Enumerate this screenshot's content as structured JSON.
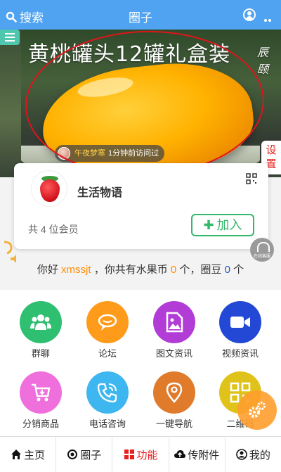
{
  "header": {
    "search_label": "搜索",
    "title": "圈子"
  },
  "banner": {
    "title": "黄桃罐头12罐礼盒装",
    "brand": "辰颐",
    "visitor_name": "午夜梦寒",
    "visit_text": "1分钟前访问过"
  },
  "settings_label": "设置",
  "circle": {
    "name": "生活物语",
    "members_text": "共 4 位会员",
    "join_label": "加入"
  },
  "greeting": {
    "prefix": "你好",
    "username": "xmssjt",
    "mid1": "，你共有水果币",
    "coins": "0",
    "mid2": "个，圈豆",
    "beans": "0",
    "suffix": "个"
  },
  "online_service_label": "在线客服",
  "features": [
    {
      "label": "群聊",
      "color": "#2fbf71",
      "icon": "group-chat-icon"
    },
    {
      "label": "论坛",
      "color": "#ff9b1a",
      "icon": "forum-icon"
    },
    {
      "label": "图文资讯",
      "color": "#b23dd6",
      "icon": "image-news-icon"
    },
    {
      "label": "视频资讯",
      "color": "#2348d6",
      "icon": "video-icon"
    },
    {
      "label": "分销商品",
      "color": "#ef6fdc",
      "icon": "cart-icon"
    },
    {
      "label": "电话咨询",
      "color": "#3eb6f0",
      "icon": "phone-icon"
    },
    {
      "label": "一键导航",
      "color": "#e07b2c",
      "icon": "location-icon"
    },
    {
      "label": "二维码",
      "color": "#e0c31a",
      "icon": "qrcode-icon"
    }
  ],
  "nav": [
    {
      "label": "主页",
      "icon": "home-icon"
    },
    {
      "label": "圈子",
      "icon": "circle-icon"
    },
    {
      "label": "功能",
      "icon": "grid-icon",
      "active": true
    },
    {
      "label": "传附件",
      "icon": "upload-cloud-icon"
    },
    {
      "label": "我的",
      "icon": "user-icon"
    }
  ]
}
